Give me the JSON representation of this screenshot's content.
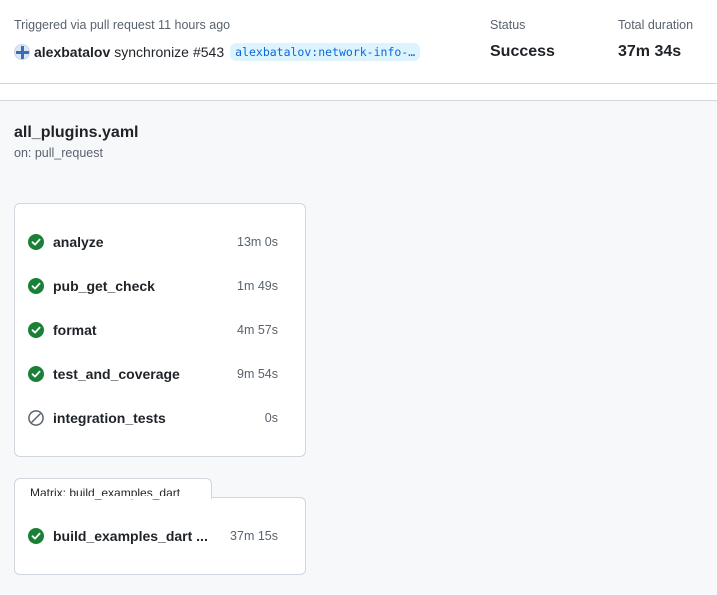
{
  "summary": {
    "trigger_label": "Triggered via pull request 11 hours ago",
    "actor": "alexbatalov",
    "event": "synchronize",
    "pr_number": "#543",
    "branch": "alexbatalov:network-info-…",
    "status_label": "Status",
    "status_value": "Success",
    "duration_label": "Total duration",
    "duration_value": "37m 34s"
  },
  "workflow": {
    "file": "all_plugins.yaml",
    "trigger": "on: pull_request"
  },
  "jobs": [
    {
      "name": "analyze",
      "time": "13m 0s",
      "status": "success",
      "icon": "check-circle-icon"
    },
    {
      "name": "pub_get_check",
      "time": "1m 49s",
      "status": "success",
      "icon": "check-circle-icon"
    },
    {
      "name": "format",
      "time": "4m 57s",
      "status": "success",
      "icon": "check-circle-icon"
    },
    {
      "name": "test_and_coverage",
      "time": "9m 54s",
      "status": "success",
      "icon": "check-circle-icon"
    },
    {
      "name": "integration_tests",
      "time": "0s",
      "status": "skipped",
      "icon": "skipped-icon"
    }
  ],
  "matrix": {
    "label": "Matrix: build_examples_dart",
    "jobs": [
      {
        "name": "build_examples_dart ...",
        "time": "37m 15s",
        "status": "success",
        "icon": "check-circle-icon"
      }
    ]
  },
  "colors": {
    "success": "#1a7f37",
    "skipped": "#59636e",
    "branch_bg": "#ddf4ff",
    "branch_text": "#0969da",
    "border": "#d0d7de"
  }
}
